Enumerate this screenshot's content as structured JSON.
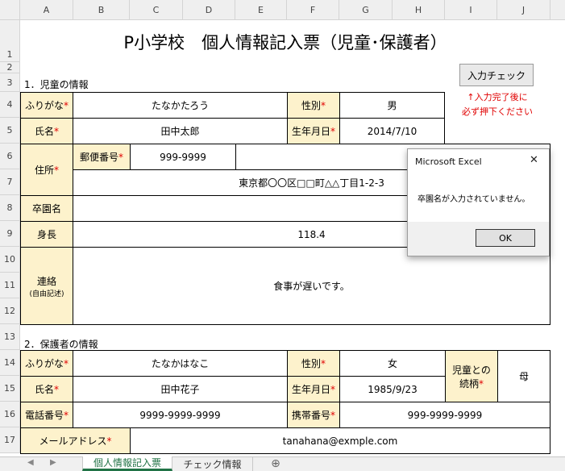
{
  "columns": [
    "A",
    "B",
    "C",
    "D",
    "E",
    "F",
    "G",
    "H",
    "I",
    "J"
  ],
  "rows": [
    "1",
    "2",
    "3",
    "4",
    "5",
    "6",
    "7",
    "8",
    "9",
    "10",
    "11",
    "12",
    "13",
    "14",
    "15",
    "16",
    "17"
  ],
  "form": {
    "title": "P小学校　個人情報記入票（児童･保護者）",
    "section1": "1．児童の情報",
    "section2": "2．保護者の情報",
    "check_button": "入力チェック",
    "check_note_line1": "↑入力完了後に",
    "check_note_line2": "必ず押下ください",
    "asterisk": "*",
    "child": {
      "furigana_label": "ふりがな",
      "furigana_value": "たなかたろう",
      "gender_label": "性別",
      "gender_value": "男",
      "name_label": "氏名",
      "name_value": "田中太郎",
      "birthday_label": "生年月日",
      "birthday_value": "2014/7/10",
      "address_label": "住所",
      "postal_label": "郵便番号",
      "postal_value": "999-9999",
      "address_value": "東京都〇〇区□□町△△丁目1-2-3",
      "kindergarten_label": "卒園名",
      "kindergarten_value": "",
      "height_label": "身長",
      "height_value": "118.4",
      "contact_label": "連絡",
      "contact_sublabel": "(自由記述)",
      "contact_value": "食事が遅いです。"
    },
    "guardian": {
      "furigana_label": "ふりがな",
      "furigana_value": "たなかはなこ",
      "gender_label": "性別",
      "gender_value": "女",
      "relation_label_1": "児童との",
      "relation_label_2": "続柄",
      "relation_value": "母",
      "name_label": "氏名",
      "name_value": "田中花子",
      "birthday_label": "生年月日",
      "birthday_value": "1985/9/23",
      "phone_label": "電話番号",
      "phone_value": "9999-9999-9999",
      "mobile_label": "携帯番号",
      "mobile_value": "999-9999-9999",
      "email_label": "メールアドレス",
      "email_value": "tanahana@exmple.com"
    }
  },
  "dialog": {
    "title": "Microsoft Excel",
    "message": "卒園名が入力されていません。",
    "ok_label": "OK",
    "close_glyph": "✕"
  },
  "sheet_tabs": {
    "active": "個人情報記入票",
    "second": "チェック情報",
    "add_glyph": "⊕"
  },
  "colors": {
    "label_bg": "#fdf2cc",
    "required": "#e00000",
    "tab_active": "#217346"
  }
}
